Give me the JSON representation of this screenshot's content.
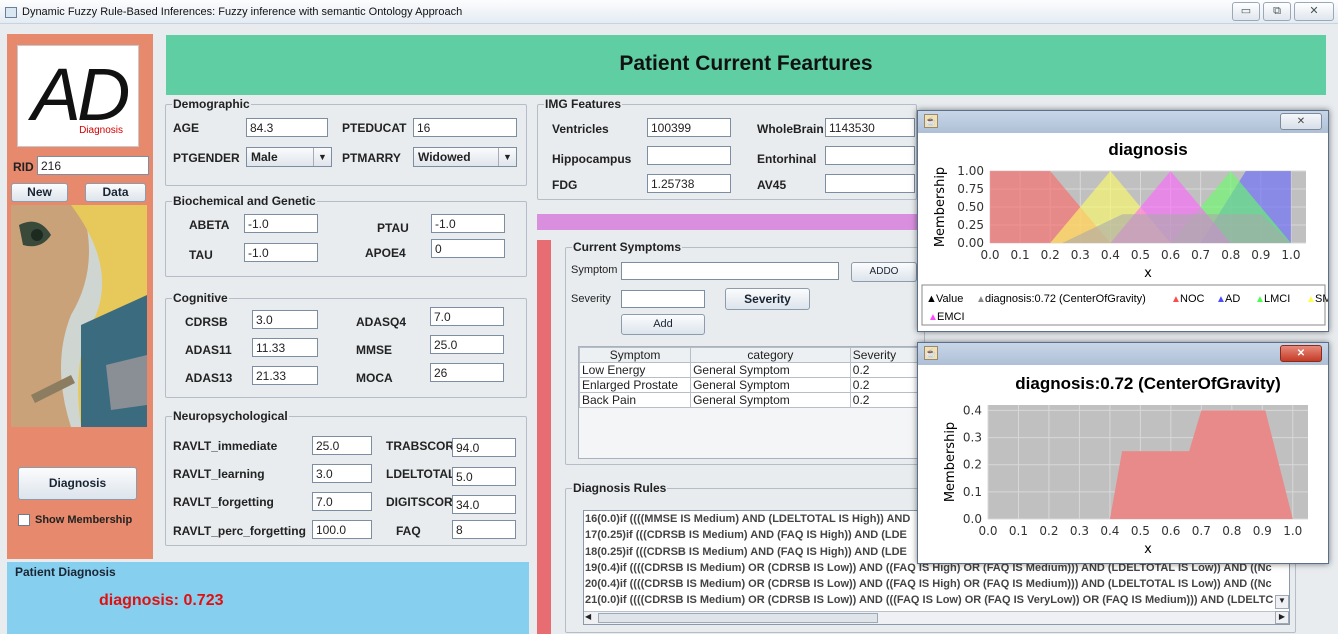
{
  "window": {
    "title": "Dynamic Fuzzy Rule-Based Inferences: Fuzzy inference with semantic Ontology Approach",
    "min": "▭",
    "max": "⧉",
    "close": "✕"
  },
  "logo": {
    "text": "AD",
    "sub": "Diagnosis"
  },
  "rid": {
    "label": "RID",
    "value": "216"
  },
  "buttons": {
    "new": "New",
    "data": "Data",
    "diagnosis": "Diagnosis",
    "severity": "Severity",
    "add": "Add",
    "addo": "ADDO"
  },
  "show_membership": "Show Membership",
  "header": "Patient Current Feartures",
  "demographic": {
    "title": "Demographic",
    "age_label": "AGE",
    "age": "84.3",
    "pteducat_label": "PTEDUCAT",
    "pteducat": "16",
    "ptgender_label": "PTGENDER",
    "ptgender": "Male",
    "ptmarry_label": "PTMARRY",
    "ptmarry": "Widowed"
  },
  "biochem": {
    "title": "Biochemical and Genetic",
    "abeta_label": "ABETA",
    "abeta": "-1.0",
    "ptau_label": "PTAU",
    "ptau": "-1.0",
    "tau_label": "TAU",
    "tau": "-1.0",
    "apoe4_label": "APOE4",
    "apoe4": "0"
  },
  "cognitive": {
    "title": "Cognitive",
    "cdrsb_label": "CDRSB",
    "cdrsb": "3.0",
    "adasq4_label": "ADASQ4",
    "adasq4": "7.0",
    "adas11_label": "ADAS11",
    "adas11": "11.33",
    "mmse_label": "MMSE",
    "mmse": "25.0",
    "adas13_label": "ADAS13",
    "adas13": "21.33",
    "moca_label": "MOCA",
    "moca": "26"
  },
  "neuro": {
    "title": "Neuropsychological",
    "ri_label": "RAVLT_immediate",
    "ri": "25.0",
    "trab_label": "TRABSCOR",
    "trab": "94.0",
    "rl_label": "RAVLT_learning",
    "rl": "3.0",
    "ldel_label": "LDELTOTAL",
    "ldel": "5.0",
    "rf_label": "RAVLT_forgetting",
    "rf": "7.0",
    "digit_label": "DIGITSCOR",
    "digit": "34.0",
    "rpf_label": "RAVLT_perc_forgetting",
    "rpf": "100.0",
    "faq_label": "FAQ",
    "faq": "8"
  },
  "img": {
    "title": "IMG Features",
    "ventricles_label": "Ventricles",
    "ventricles": "100399",
    "wholebrain_label": "WholeBrain",
    "wholebrain": "1143530",
    "hippo_label": "Hippocampus",
    "hippo": "",
    "entorhinal_label": "Entorhinal",
    "entorhinal": "",
    "fdg_label": "FDG",
    "fdg": "1.25738",
    "av45_label": "AV45",
    "av45": ""
  },
  "symptoms": {
    "title": "Current Symptoms",
    "symptom_label": "Symptom",
    "severity_label": "Severity",
    "headers": [
      "Symptom",
      "category",
      "Severity"
    ],
    "rows": [
      [
        "Low Energy",
        "General Symptom",
        "0.2"
      ],
      [
        "Enlarged Prostate",
        "General Symptom",
        "0.2"
      ],
      [
        "Back Pain",
        "General Symptom",
        "0.2"
      ]
    ]
  },
  "rules": {
    "title": "Diagnosis Rules",
    "items": [
      "16(0.0)if ((((MMSE IS Medium) AND (LDELTOTAL IS High)) AND",
      "17(0.25)if (((CDRSB IS Medium) AND (FAQ IS High)) AND (LDE",
      "18(0.25)if (((CDRSB IS Medium) AND (FAQ IS High)) AND (LDE",
      "19(0.4)if ((((CDRSB IS Medium) OR (CDRSB IS Low)) AND ((FAQ IS High) OR (FAQ IS Medium))) AND (LDELTOTAL IS Low)) AND ((Nc",
      "20(0.4)if ((((CDRSB IS Medium) OR (CDRSB IS Low)) AND ((FAQ IS High) OR (FAQ IS Medium))) AND (LDELTOTAL IS Low)) AND ((Nc",
      "21(0.0)if ((((CDRSB IS Medium) OR (CDRSB IS Low)) AND (((FAQ IS Low) OR (FAQ IS VeryLow)) OR (FAQ IS Medium))) AND (LDELTC"
    ]
  },
  "patient_diagnosis": {
    "title": "Patient Diagnosis",
    "value": "diagnosis: 0.723"
  },
  "chart_data": [
    {
      "type": "area",
      "title": "diagnosis",
      "xlabel": "x",
      "ylabel": "Membership",
      "xlim": [
        0,
        1.05
      ],
      "ylim": [
        0,
        1
      ],
      "xticks": [
        "0.0",
        "0.1",
        "0.2",
        "0.3",
        "0.4",
        "0.5",
        "0.6",
        "0.7",
        "0.8",
        "0.9",
        "1.0"
      ],
      "yticks": [
        "0.00",
        "0.25",
        "0.50",
        "0.75",
        "1.00"
      ],
      "series": [
        {
          "name": "NOC",
          "color": "#ff6464",
          "x": [
            0,
            0.2,
            0.4
          ],
          "y": [
            1,
            1,
            0
          ]
        },
        {
          "name": "AD",
          "color": "#6464ff",
          "x": [
            0.7,
            0.85,
            1.0,
            1.0
          ],
          "y": [
            0,
            1,
            1,
            0
          ]
        },
        {
          "name": "LMCI",
          "color": "#64ff64",
          "x": [
            0.6,
            0.8,
            1.0
          ],
          "y": [
            0,
            1,
            0
          ]
        },
        {
          "name": "SMC",
          "color": "#ffff64",
          "x": [
            0.2,
            0.4,
            0.6
          ],
          "y": [
            0,
            1,
            0
          ]
        },
        {
          "name": "EMCI",
          "color": "#ff64ff",
          "x": [
            0.4,
            0.6,
            0.8
          ],
          "y": [
            0,
            1,
            0
          ]
        },
        {
          "name": "diagnosis:0.72 (CenterOfGravity)",
          "color": "#aaaaaa",
          "x": [
            0.24,
            0.44,
            0.9,
            1.0
          ],
          "y": [
            0,
            0.4,
            0.4,
            0
          ]
        }
      ],
      "legend": {
        "value": "Value",
        "items": [
          "diagnosis:0.72 (CenterOfGravity)",
          "NOC",
          "AD",
          "LMCI",
          "SMC",
          "EMCI"
        ],
        "colors": [
          "#888888",
          "#ff4a4a",
          "#4a4aff",
          "#4aff4a",
          "#ffff4a",
          "#ff4aff"
        ]
      }
    },
    {
      "type": "area",
      "title": "diagnosis:0.72 (CenterOfGravity)",
      "xlabel": "x",
      "ylabel": "Membership",
      "xlim": [
        0,
        1.05
      ],
      "ylim": [
        0,
        0.42
      ],
      "xticks": [
        "0.0",
        "0.1",
        "0.2",
        "0.3",
        "0.4",
        "0.5",
        "0.6",
        "0.7",
        "0.8",
        "0.9",
        "1.0"
      ],
      "yticks": [
        "0.0",
        "0.1",
        "0.2",
        "0.3",
        "0.4"
      ],
      "series": [
        {
          "name": "diagnosis",
          "color": "#e88a8a",
          "x": [
            0.4,
            0.44,
            0.66,
            0.7,
            0.91,
            1.0
          ],
          "y": [
            0,
            0.25,
            0.25,
            0.4,
            0.4,
            0
          ]
        }
      ]
    }
  ]
}
